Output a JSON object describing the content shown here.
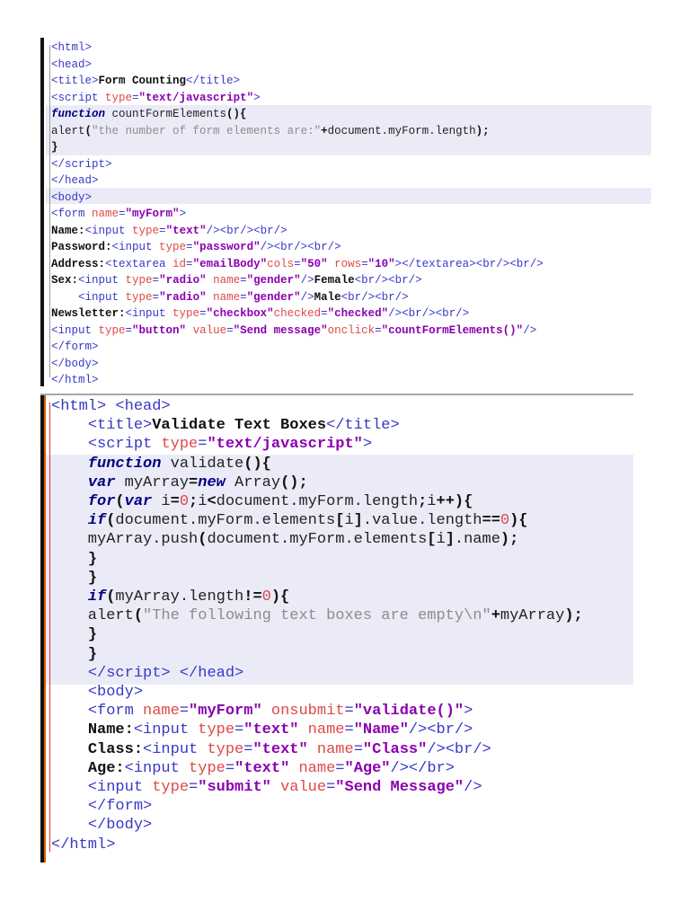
{
  "blocks": [
    {
      "lines": [
        [
          [
            "t",
            "<html>"
          ]
        ],
        [
          [
            "t",
            "<head>"
          ]
        ],
        [
          [
            "t",
            "<title>"
          ],
          [
            "b",
            "Form Counting"
          ],
          [
            "t",
            "</title>"
          ]
        ],
        [
          [
            "t",
            "<script "
          ],
          [
            "a",
            "type"
          ],
          [
            "t",
            "="
          ],
          [
            "v",
            "\"text/javascript\""
          ],
          [
            "t",
            ">"
          ]
        ],
        [
          [
            "k",
            "function"
          ],
          [
            "p",
            " countFormElements"
          ],
          [
            "b",
            "(){"
          ]
        ],
        [
          [
            "p",
            "alert"
          ],
          [
            "b",
            "("
          ],
          [
            "s",
            "\"the number of form elements are:\""
          ],
          [
            "b",
            "+"
          ],
          [
            "p",
            "document.myForm.length"
          ],
          [
            "b",
            ");"
          ]
        ],
        [
          [
            "b",
            "}"
          ]
        ],
        [
          [
            "t",
            "</script>"
          ]
        ],
        [
          [
            "t",
            "</head>"
          ]
        ],
        [
          [
            "t",
            "<body>"
          ]
        ],
        [
          [
            "t",
            "<form "
          ],
          [
            "a",
            "name"
          ],
          [
            "t",
            "="
          ],
          [
            "v",
            "\"myForm\""
          ],
          [
            "t",
            ">"
          ]
        ],
        [
          [
            "b",
            "Name:"
          ],
          [
            "t",
            "<input "
          ],
          [
            "a",
            "type"
          ],
          [
            "t",
            "="
          ],
          [
            "v",
            "\"text\""
          ],
          [
            "t",
            "/><br/><br/>"
          ]
        ],
        [
          [
            "b",
            "Password:"
          ],
          [
            "t",
            "<input "
          ],
          [
            "a",
            "type"
          ],
          [
            "t",
            "="
          ],
          [
            "v",
            "\"password\""
          ],
          [
            "t",
            "/><br/><br/>"
          ]
        ],
        [
          [
            "b",
            "Address:"
          ],
          [
            "t",
            "<textarea "
          ],
          [
            "a",
            "id"
          ],
          [
            "t",
            "="
          ],
          [
            "v",
            "\"emailBody\""
          ],
          [
            "a",
            "cols"
          ],
          [
            "t",
            "="
          ],
          [
            "v",
            "\"50\""
          ],
          [
            "a",
            " rows"
          ],
          [
            "t",
            "="
          ],
          [
            "v",
            "\"10\""
          ],
          [
            "t",
            "></textarea><br/><br/>"
          ]
        ],
        [
          [
            "b",
            "Sex:"
          ],
          [
            "t",
            "<input "
          ],
          [
            "a",
            "type"
          ],
          [
            "t",
            "="
          ],
          [
            "v",
            "\"radio\""
          ],
          [
            "a",
            " name"
          ],
          [
            "t",
            "="
          ],
          [
            "v",
            "\"gender\""
          ],
          [
            "t",
            "/>"
          ],
          [
            "b",
            "Female"
          ],
          [
            "t",
            "<br/><br/>"
          ]
        ],
        [
          [
            "p",
            "    "
          ],
          [
            "t",
            "<input "
          ],
          [
            "a",
            "type"
          ],
          [
            "t",
            "="
          ],
          [
            "v",
            "\"radio\""
          ],
          [
            "a",
            " name"
          ],
          [
            "t",
            "="
          ],
          [
            "v",
            "\"gender\""
          ],
          [
            "t",
            "/>"
          ],
          [
            "b",
            "Male"
          ],
          [
            "t",
            "<br/><br/>"
          ]
        ],
        [
          [
            "b",
            "Newsletter:"
          ],
          [
            "t",
            "<input "
          ],
          [
            "a",
            "type"
          ],
          [
            "t",
            "="
          ],
          [
            "v",
            "\"checkbox\""
          ],
          [
            "a",
            "checked"
          ],
          [
            "t",
            "="
          ],
          [
            "v",
            "\"checked\""
          ],
          [
            "t",
            "/><br/><br/>"
          ]
        ],
        [
          [
            "t",
            "<input "
          ],
          [
            "a",
            "type"
          ],
          [
            "t",
            "="
          ],
          [
            "v",
            "\"button\""
          ],
          [
            "a",
            " value"
          ],
          [
            "t",
            "="
          ],
          [
            "v",
            "\"Send message\""
          ],
          [
            "a",
            "onclick"
          ],
          [
            "t",
            "="
          ],
          [
            "v",
            "\"countFormElements()\""
          ],
          [
            "t",
            "/>"
          ]
        ],
        [
          [
            "t",
            "</form>"
          ]
        ],
        [
          [
            "t",
            "</body>"
          ]
        ],
        [
          [
            "t",
            "</html>"
          ]
        ]
      ]
    },
    {
      "lines": [
        [
          [
            "t",
            "<html> <head>"
          ]
        ],
        [
          [
            "p",
            "    "
          ],
          [
            "t",
            "<title>"
          ],
          [
            "b",
            "Validate Text Boxes"
          ],
          [
            "t",
            "</title>"
          ]
        ],
        [
          [
            "p",
            "    "
          ],
          [
            "t",
            "<script "
          ],
          [
            "a",
            "type"
          ],
          [
            "t",
            "="
          ],
          [
            "v",
            "\"text/javascript\""
          ],
          [
            "t",
            ">"
          ]
        ],
        [
          [
            "p",
            "    "
          ],
          [
            "k",
            "function"
          ],
          [
            "p",
            " validate"
          ],
          [
            "b",
            "(){"
          ]
        ],
        [
          [
            "p",
            "    "
          ],
          [
            "k",
            "var"
          ],
          [
            "p",
            " myArray"
          ],
          [
            "b",
            "="
          ],
          [
            "k",
            "new"
          ],
          [
            "p",
            " Array"
          ],
          [
            "b",
            "();"
          ]
        ],
        [
          [
            "p",
            "    "
          ],
          [
            "k",
            "for"
          ],
          [
            "b",
            "("
          ],
          [
            "k",
            "var"
          ],
          [
            "p",
            " i"
          ],
          [
            "b",
            "="
          ],
          [
            "n",
            "0"
          ],
          [
            "b",
            ";"
          ],
          [
            "p",
            "i"
          ],
          [
            "b",
            "<"
          ],
          [
            "p",
            "document.myForm.length"
          ],
          [
            "b",
            ";"
          ],
          [
            "p",
            "i"
          ],
          [
            "b",
            "++){"
          ]
        ],
        [
          [
            "p",
            "    "
          ],
          [
            "k",
            "if"
          ],
          [
            "b",
            "("
          ],
          [
            "p",
            "document.myForm.elements"
          ],
          [
            "b",
            "["
          ],
          [
            "p",
            "i"
          ],
          [
            "b",
            "]"
          ],
          [
            "p",
            ".value.length"
          ],
          [
            "b",
            "=="
          ],
          [
            "n",
            "0"
          ],
          [
            "b",
            "){"
          ]
        ],
        [
          [
            "p",
            "    myArray.push"
          ],
          [
            "b",
            "("
          ],
          [
            "p",
            "document.myForm.elements"
          ],
          [
            "b",
            "["
          ],
          [
            "p",
            "i"
          ],
          [
            "b",
            "]"
          ],
          [
            "p",
            ".name"
          ],
          [
            "b",
            ");"
          ]
        ],
        [
          [
            "p",
            "    "
          ],
          [
            "b",
            "}"
          ]
        ],
        [
          [
            "p",
            "    "
          ],
          [
            "b",
            "}"
          ]
        ],
        [
          [
            "p",
            "    "
          ],
          [
            "k",
            "if"
          ],
          [
            "b",
            "("
          ],
          [
            "p",
            "myArray.length"
          ],
          [
            "b",
            "!="
          ],
          [
            "n",
            "0"
          ],
          [
            "b",
            "){"
          ]
        ],
        [
          [
            "p",
            "    alert"
          ],
          [
            "b",
            "("
          ],
          [
            "s",
            "\"The following text boxes are empty\\n\""
          ],
          [
            "b",
            "+"
          ],
          [
            "p",
            "myArray"
          ],
          [
            "b",
            ");"
          ]
        ],
        [
          [
            "p",
            "    "
          ],
          [
            "b",
            "}"
          ]
        ],
        [
          [
            "p",
            "    "
          ],
          [
            "b",
            "}"
          ]
        ],
        [
          [
            "p",
            "    "
          ],
          [
            "t",
            "</script> "
          ],
          [
            "t",
            "</head>"
          ]
        ],
        [
          [
            "p",
            "    "
          ],
          [
            "t",
            "<body>"
          ]
        ],
        [
          [
            "p",
            "    "
          ],
          [
            "t",
            "<form "
          ],
          [
            "a",
            "name"
          ],
          [
            "t",
            "="
          ],
          [
            "v",
            "\"myForm\""
          ],
          [
            "a",
            " onsubmit"
          ],
          [
            "t",
            "="
          ],
          [
            "v",
            "\"validate()\""
          ],
          [
            "t",
            ">"
          ]
        ],
        [
          [
            "p",
            "    "
          ],
          [
            "b",
            "Name:"
          ],
          [
            "t",
            "<input "
          ],
          [
            "a",
            "type"
          ],
          [
            "t",
            "="
          ],
          [
            "v",
            "\"text\""
          ],
          [
            "a",
            " name"
          ],
          [
            "t",
            "="
          ],
          [
            "v",
            "\"Name\""
          ],
          [
            "t",
            "/><br/>"
          ]
        ],
        [
          [
            "p",
            "    "
          ],
          [
            "b",
            "Class:"
          ],
          [
            "t",
            "<input "
          ],
          [
            "a",
            "type"
          ],
          [
            "t",
            "="
          ],
          [
            "v",
            "\"text\""
          ],
          [
            "a",
            " name"
          ],
          [
            "t",
            "="
          ],
          [
            "v",
            "\"Class\""
          ],
          [
            "t",
            "/><br/>"
          ]
        ],
        [
          [
            "p",
            "    "
          ],
          [
            "b",
            "Age:"
          ],
          [
            "t",
            "<input "
          ],
          [
            "a",
            "type"
          ],
          [
            "t",
            "="
          ],
          [
            "v",
            "\"text\""
          ],
          [
            "a",
            " name"
          ],
          [
            "t",
            "="
          ],
          [
            "v",
            "\"Age\""
          ],
          [
            "t",
            "/></br>"
          ]
        ],
        [
          [
            "p",
            "    "
          ],
          [
            "t",
            "<input "
          ],
          [
            "a",
            "type"
          ],
          [
            "t",
            "="
          ],
          [
            "v",
            "\"submit\""
          ],
          [
            "a",
            " value"
          ],
          [
            "t",
            "="
          ],
          [
            "v",
            "\"Send Message\""
          ],
          [
            "t",
            "/>"
          ]
        ],
        [
          [
            "p",
            "    "
          ],
          [
            "t",
            "</form>"
          ]
        ],
        [
          [
            "p",
            "    "
          ],
          [
            "t",
            "</body>"
          ]
        ],
        [
          [
            "t",
            "</html>"
          ]
        ]
      ]
    }
  ],
  "colors": {
    "tag": "#3838c8",
    "attr": "#e04848",
    "value": "#8a00b0",
    "keyword": "#000080",
    "string": "#8c8c8c",
    "highlight": "#ebebf8"
  }
}
